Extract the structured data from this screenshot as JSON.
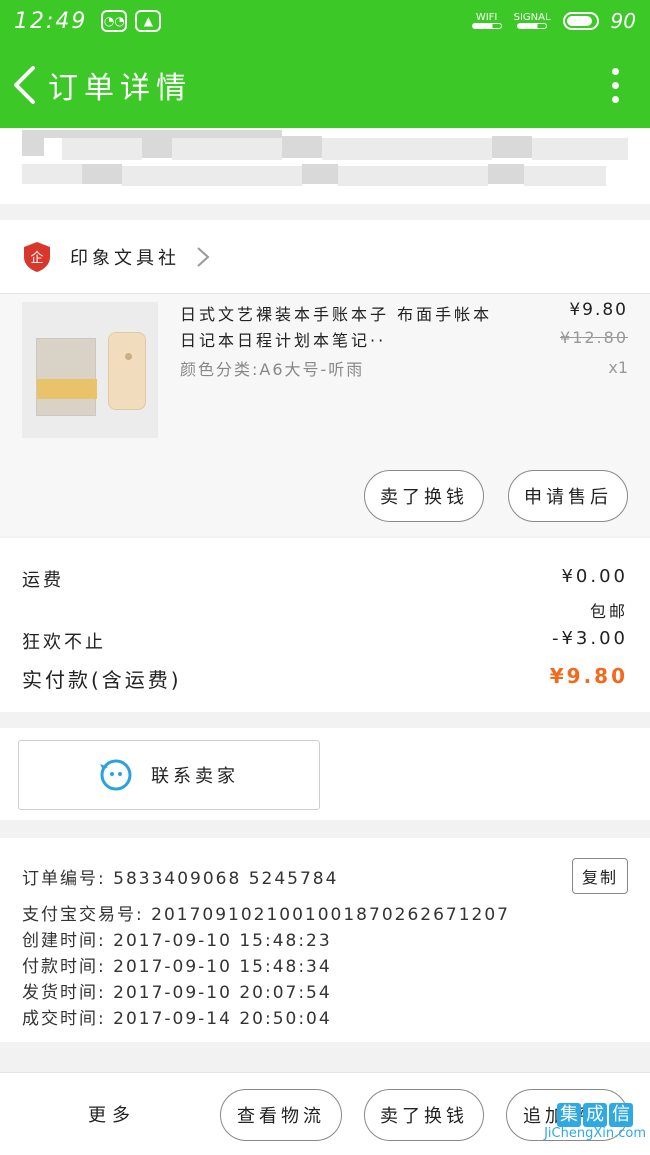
{
  "status_bar": {
    "time": "12:49",
    "wifi_label": "WIFI",
    "signal_label": "SIGNAL",
    "battery": "90"
  },
  "app_bar": {
    "title": "订单详情"
  },
  "shop": {
    "name": "印象文具社"
  },
  "product": {
    "title": "日式文艺裸装本手账本子  布面手帐本日记本日程计划本笔记··",
    "spec": "颜色分类:A6大号-听雨",
    "price": "¥9.80",
    "original_price": "¥12.80",
    "quantity": "x1",
    "buttons": {
      "refund": "卖了换钱",
      "after_sale": "申请售后"
    }
  },
  "fees": {
    "shipping_label": "运费",
    "shipping_value": "¥0.00",
    "shipping_note": "包邮",
    "discount_label": "狂欢不止",
    "discount_value": "-¥3.00",
    "total_label": "实付款(含运费)",
    "total_value": "¥9.80"
  },
  "contact": {
    "label": "联系卖家"
  },
  "order_info": {
    "order_no": "订单编号: 5833409068 5245784",
    "copy_label": "复制",
    "alipay_no": "支付宝交易号: 2017091021001001870262671207",
    "created": "创建时间: 2017-09-10  15:48:23",
    "paid": "付款时间: 2017-09-10  15:48:34",
    "shipped": "发货时间: 2017-09-10  20:07:54",
    "completed": "成交时间: 2017-09-14  20:50:04"
  },
  "bottom_bar": {
    "more": "更多",
    "logistics": "查看物流",
    "resell": "卖了换钱",
    "review": "追加评价",
    "watermark": "JiChengXin.com",
    "watermark_chars": [
      "集",
      "成",
      "信"
    ]
  },
  "colors": {
    "brand_green": "#3cc827",
    "price_orange": "#f46a1d",
    "shop_badge_red": "#d9372b",
    "chat_blue": "#29a3e0"
  }
}
